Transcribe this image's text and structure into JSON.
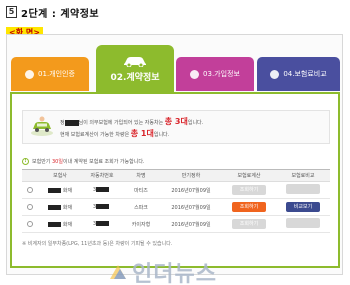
{
  "header": {
    "step_number": "5",
    "title": "2단계 : 계약정보"
  },
  "screen_label": "<화 면>",
  "tabs": [
    {
      "label": "01.개인인증"
    },
    {
      "label": "02.계약정보"
    },
    {
      "label": "03.가입정보"
    },
    {
      "label": "04.보험료비교"
    }
  ],
  "info": {
    "name_prefix": "정",
    "line1_suffix": "님이 의무보험에 가입되어 있는 자동차는 ",
    "total_cars": "총 3대",
    "line1_end": "입니다.",
    "line2_prefix": "현재 보험료계산이 가능한 차량은 ",
    "available_cars": "총 1대",
    "line2_end": "입니다."
  },
  "notice": {
    "badge": "!",
    "prefix": "보험만기 ",
    "highlight": "30일",
    "suffix": "이내 계약된 보험료 조회가 가능합니다."
  },
  "table": {
    "headers": [
      "",
      "보험사",
      "자동차번호",
      "차명",
      "만기정하",
      "보험료계산",
      "보험료비교"
    ],
    "rows": [
      {
        "insurer": "화재",
        "car_no": "3",
        "car_name": "마티즈",
        "expiry": "2016년07월09일",
        "calc_label": "조회하기",
        "calc_state": "gray",
        "compare_label": "",
        "compare_state": "gray"
      },
      {
        "insurer": "화재",
        "car_no": "3",
        "car_name": "스파크",
        "expiry": "2016년07월09일",
        "calc_label": "조회하기",
        "calc_state": "orange",
        "compare_label": "비교보기",
        "compare_state": "navy"
      },
      {
        "insurer": "화재",
        "car_no": "3",
        "car_name": "카이자형",
        "expiry": "2016년07월09일",
        "calc_label": "조회하기",
        "calc_state": "gray",
        "compare_label": "",
        "compare_state": "gray"
      }
    ]
  },
  "foot_note": "※ 비계자의 일부차종(LPG, 11년초과 등)은 차량이 기피될 수 있습니다.",
  "watermark": "인더뉴스",
  "colors": {
    "tab1": "#f39a1c",
    "tab2": "#8dbb2d",
    "tab3": "#c23f9a",
    "tab4": "#4a4f9f",
    "accent_red": "#d9262c"
  },
  "icons": [
    "car-icon",
    "car-illustration-icon",
    "alert-icon",
    "radio-icon",
    "watermark-logo-icon"
  ]
}
